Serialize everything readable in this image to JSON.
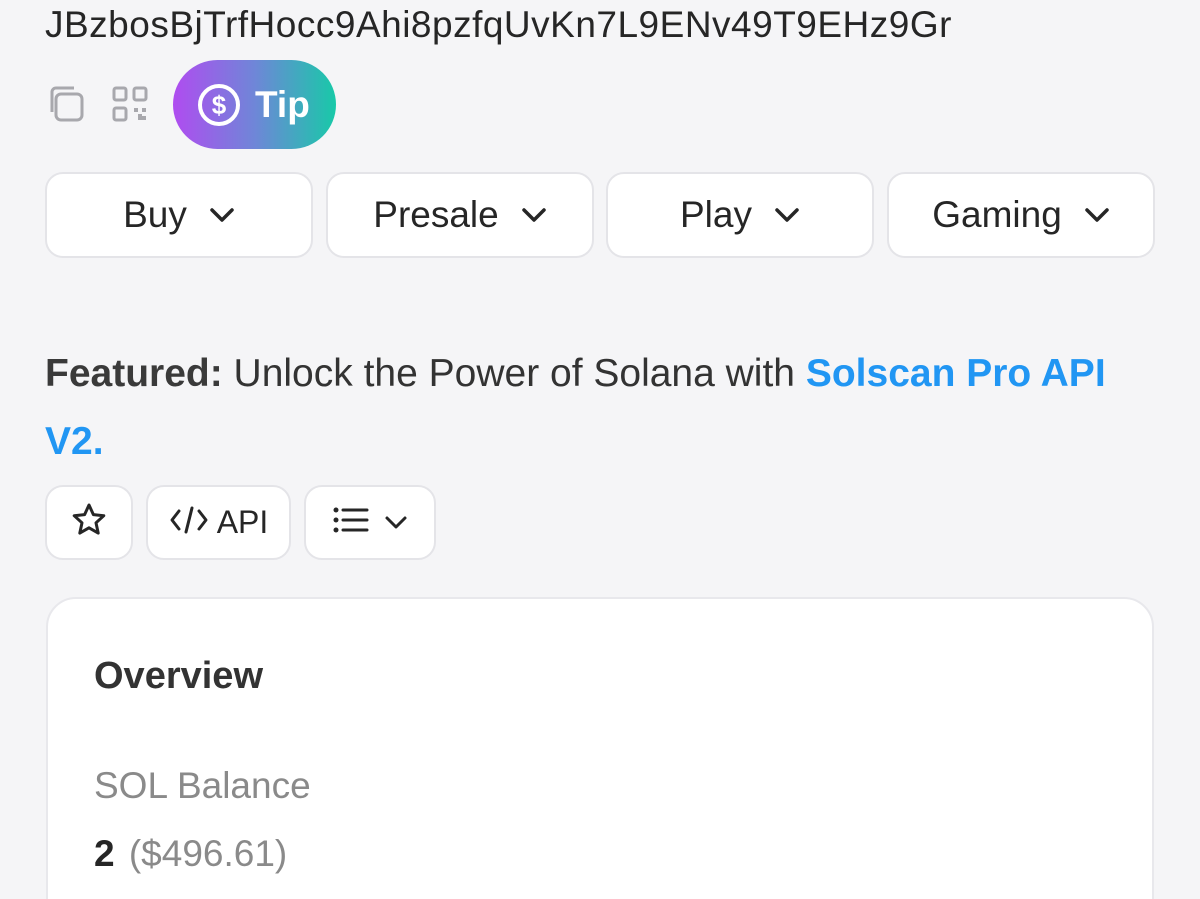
{
  "account": {
    "address": "JBzbosBjTrfHocc9Ahi8pzfqUvKn7L9ENv49T9EHz9Gr",
    "actions": {
      "copy_icon": "copy-icon",
      "qr_icon": "qr-code-icon",
      "tip_label": "Tip",
      "tip_icon": "dollar-coin-icon"
    }
  },
  "nav": {
    "items": [
      {
        "label": "Buy"
      },
      {
        "label": "Presale"
      },
      {
        "label": "Play"
      },
      {
        "label": "Gaming"
      }
    ]
  },
  "featured": {
    "lead": "Featured:",
    "text": " Unlock the Power of Solana with ",
    "link": "Solscan Pro API V2."
  },
  "toolbar": {
    "favorite_icon": "star-icon",
    "api_label": "API",
    "menu_icon": "list-icon"
  },
  "overview": {
    "title": "Overview",
    "sol_balance_label": "SOL Balance",
    "sol_balance_value": "2",
    "sol_balance_usd": "($496.61)"
  },
  "colors": {
    "link": "#2196f3",
    "tip_gradient_start": "#b04cf0",
    "tip_gradient_end": "#18c9a8",
    "background": "#f5f5f7"
  }
}
